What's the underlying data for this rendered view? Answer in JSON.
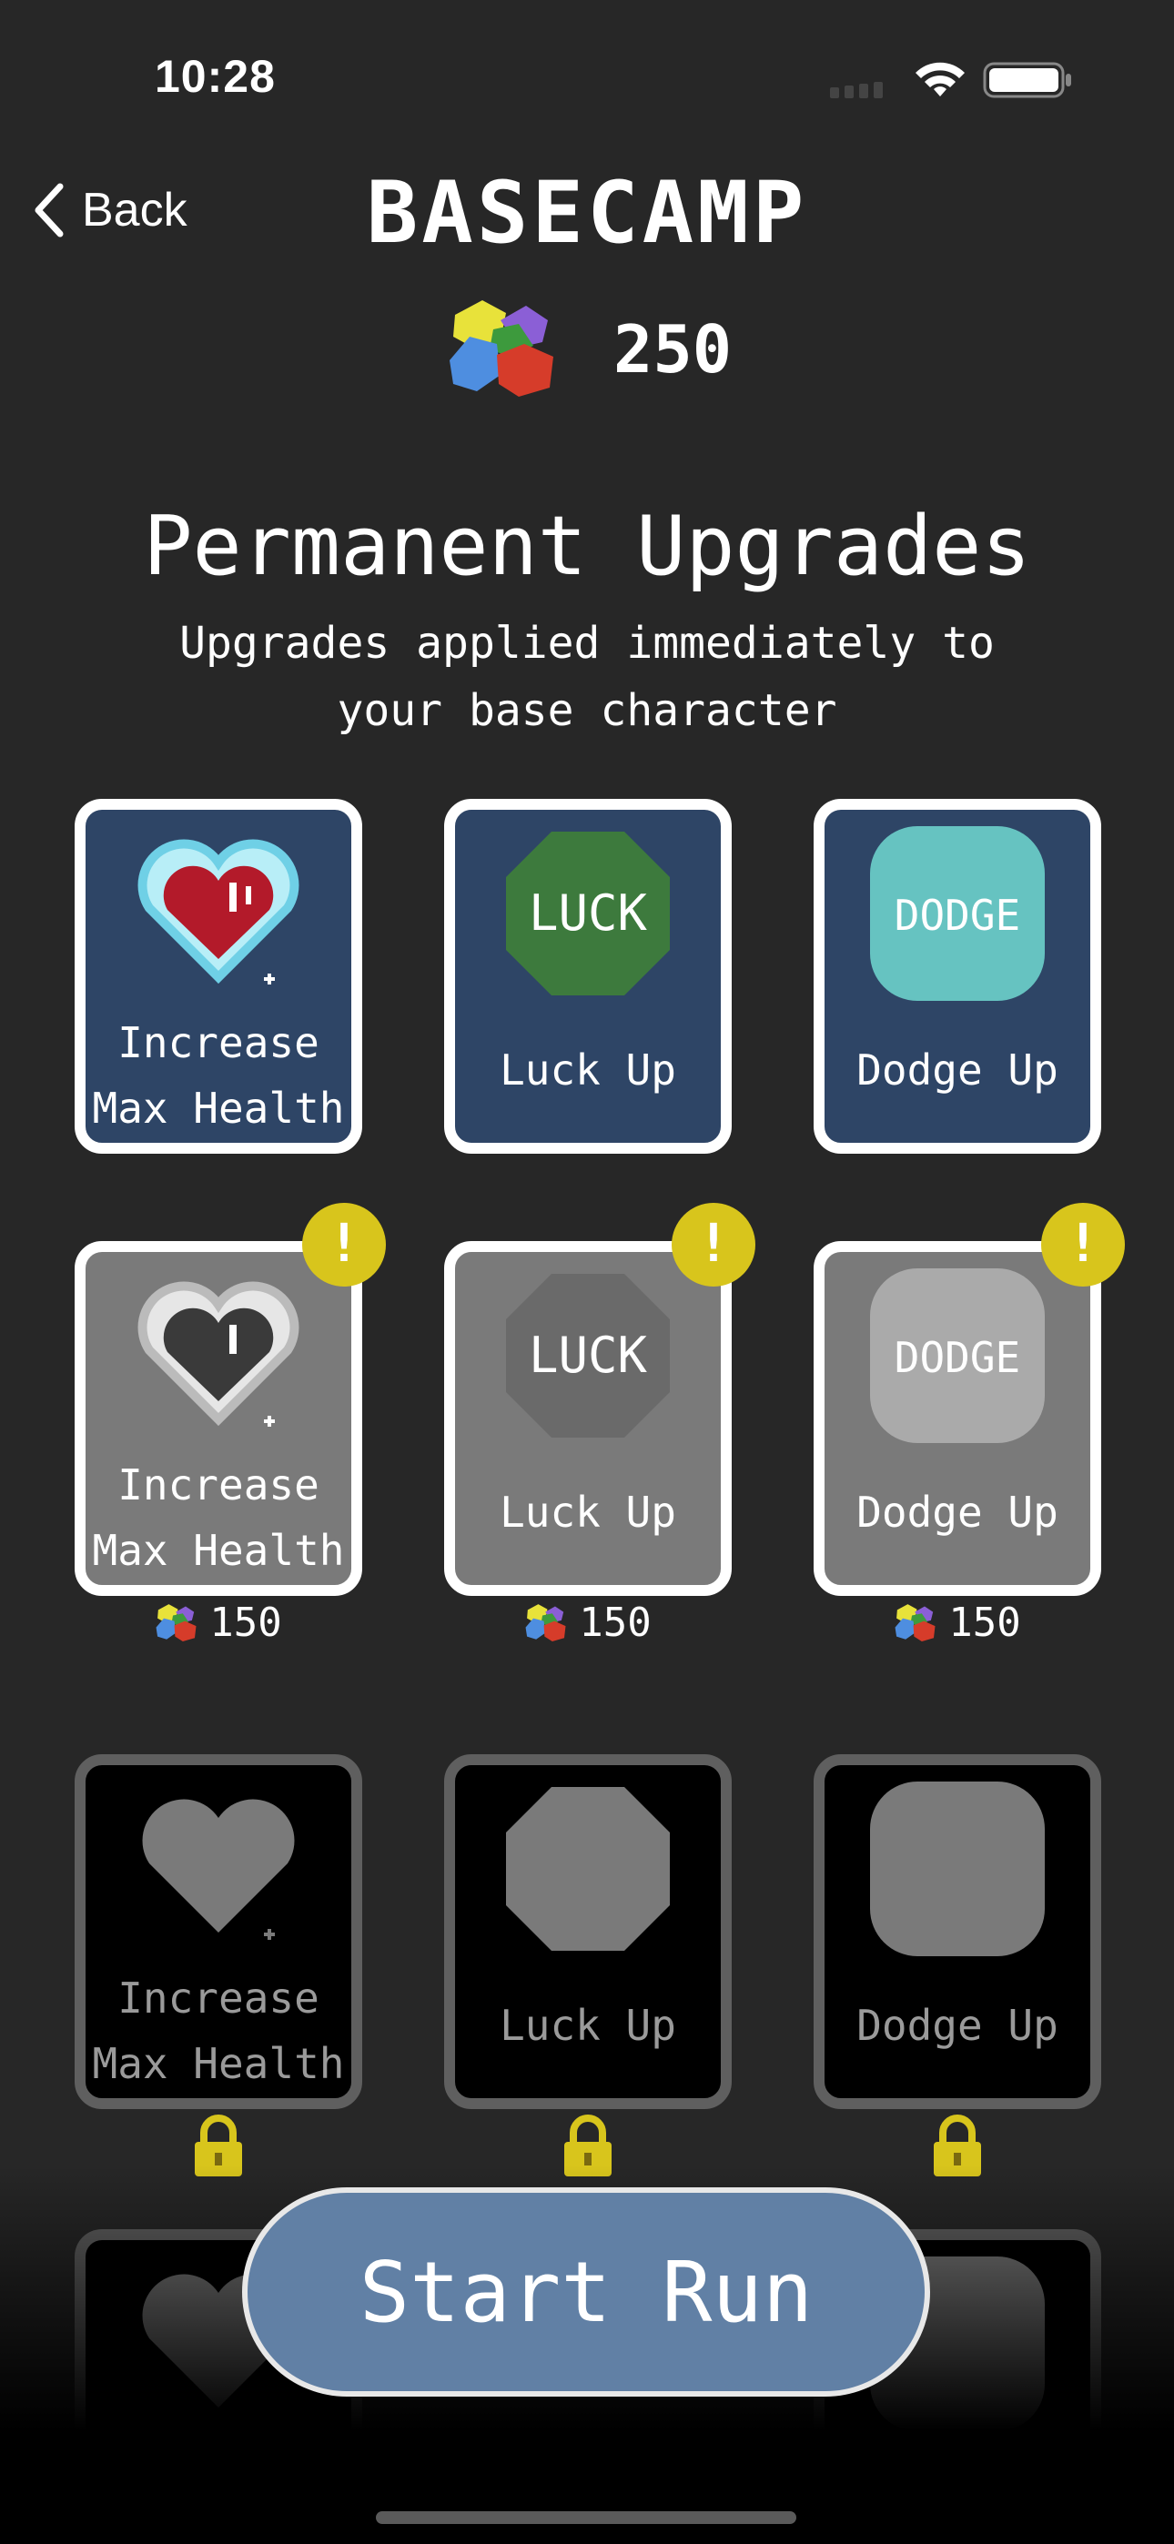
{
  "status": {
    "time": "10:28",
    "icons": [
      "cellular-icon",
      "wifi-icon",
      "battery-icon"
    ]
  },
  "nav": {
    "back_label": "Back",
    "title": "BASECAMP"
  },
  "currency": {
    "icon": "gems-icon",
    "value": "250"
  },
  "section": {
    "title": "Permanent Upgrades",
    "subtitle": "Upgrades applied immediately to your base character"
  },
  "rows": [
    {
      "state": "owned",
      "cards": [
        {
          "label": "Increase Max Health",
          "icon": "heart-icon"
        },
        {
          "label": "Luck Up",
          "icon": "luck-icon",
          "icon_text": "LUCK"
        },
        {
          "label": "Dodge Up",
          "icon": "dodge-icon",
          "icon_text": "DODGE"
        }
      ]
    },
    {
      "state": "available",
      "badge": "!",
      "cards": [
        {
          "label": "Increase Max Health",
          "icon": "heart-icon",
          "price": "150"
        },
        {
          "label": "Luck Up",
          "icon": "luck-icon",
          "icon_text": "LUCK",
          "price": "150"
        },
        {
          "label": "Dodge Up",
          "icon": "dodge-icon",
          "icon_text": "DODGE",
          "price": "150"
        }
      ]
    },
    {
      "state": "locked",
      "cards": [
        {
          "label": "Increase Max Health",
          "icon": "heart-icon"
        },
        {
          "label": "Luck Up",
          "icon": "luck-icon"
        },
        {
          "label": "Dodge Up",
          "icon": "dodge-icon"
        }
      ]
    }
  ],
  "colors": {
    "background": "#272727",
    "owned_card": "#2e4566",
    "available_card": "#7a7a7a",
    "locked_card": "#000000",
    "luck_green": "#3d7a3d",
    "dodge_teal": "#66c3c1",
    "badge_yellow": "#d8c51c",
    "start_button": "#6180a5"
  },
  "start_button": {
    "label": "Start Run"
  }
}
